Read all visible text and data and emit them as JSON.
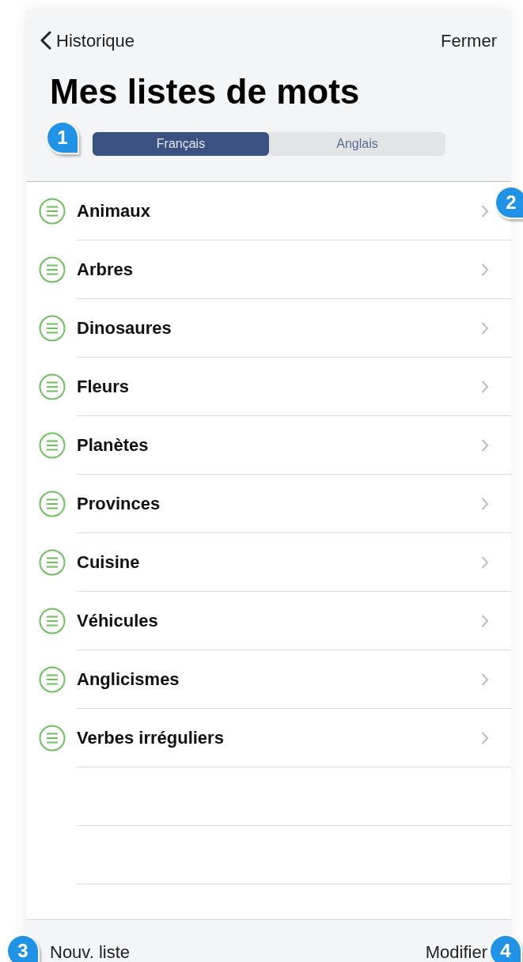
{
  "nav": {
    "back": "Historique",
    "close": "Fermer"
  },
  "title": "Mes listes de mots",
  "segments": [
    {
      "label": "Français",
      "selected": true
    },
    {
      "label": "Anglais",
      "selected": false
    }
  ],
  "lists": [
    {
      "label": "Animaux"
    },
    {
      "label": "Arbres"
    },
    {
      "label": "Dinosaures"
    },
    {
      "label": "Fleurs"
    },
    {
      "label": "Planètes"
    },
    {
      "label": "Provinces"
    },
    {
      "label": "Cuisine"
    },
    {
      "label": "Véhicules"
    },
    {
      "label": "Anglicismes"
    },
    {
      "label": "Verbes irréguliers"
    }
  ],
  "toolbar": {
    "new_list": "Nouv. liste",
    "edit": "Modifier"
  },
  "callouts": [
    "1",
    "2",
    "3",
    "4"
  ]
}
